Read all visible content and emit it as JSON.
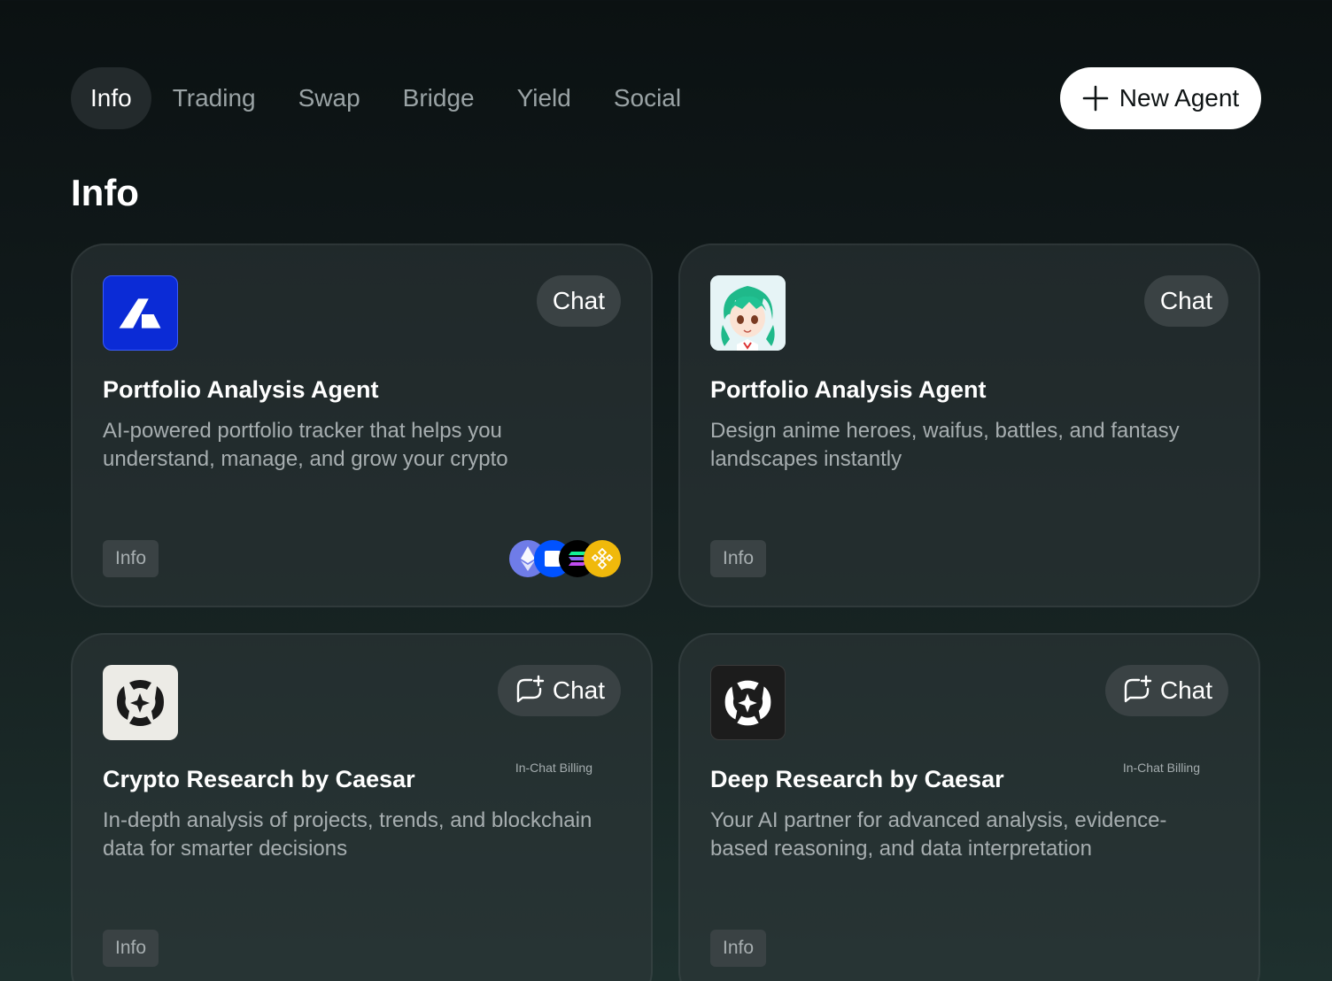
{
  "tabs": [
    {
      "label": "Info",
      "active": true
    },
    {
      "label": "Trading",
      "active": false
    },
    {
      "label": "Swap",
      "active": false
    },
    {
      "label": "Bridge",
      "active": false
    },
    {
      "label": "Yield",
      "active": false
    },
    {
      "label": "Social",
      "active": false
    }
  ],
  "new_agent_label": "New Agent",
  "section_title": "Info",
  "cards": [
    {
      "title": "Portfolio Analysis Agent",
      "description": "AI-powered portfolio tracker that helps you understand, manage, and grow your crypto",
      "chat_label": "Chat",
      "tag": "Info",
      "icon": "portfolio-logo-icon",
      "chains": [
        "ethereum-icon",
        "base-icon",
        "solana-icon",
        "bnb-icon"
      ]
    },
    {
      "title": "Portfolio Analysis Agent",
      "description": "Design anime heroes, waifus, battles, and fantasy landscapes instantly",
      "chat_label": "Chat",
      "tag": "Info",
      "icon": "anime-avatar-icon"
    },
    {
      "title": "Crypto Research by Caesar",
      "description": "In-depth analysis of projects, trends, and blockchain data for smarter decisions",
      "chat_label": "Chat",
      "billing": "In-Chat Billing",
      "tag": "Info",
      "icon": "caesar-logo-icon"
    },
    {
      "title": "Deep Research by Caesar",
      "description": "Your AI partner for advanced analysis, evidence-based reasoning, and data interpretation",
      "chat_label": "Chat",
      "billing": "In-Chat Billing",
      "tag": "Info",
      "icon": "caesar-logo-icon"
    }
  ],
  "colors": {
    "tab_active_bg": "#232a2c",
    "button_bg": "#3a4244",
    "eth": "#6f7ce8",
    "base": "#0052ff",
    "bnb": "#f0b90b",
    "portfolio_logo": "#0b2bd6"
  }
}
